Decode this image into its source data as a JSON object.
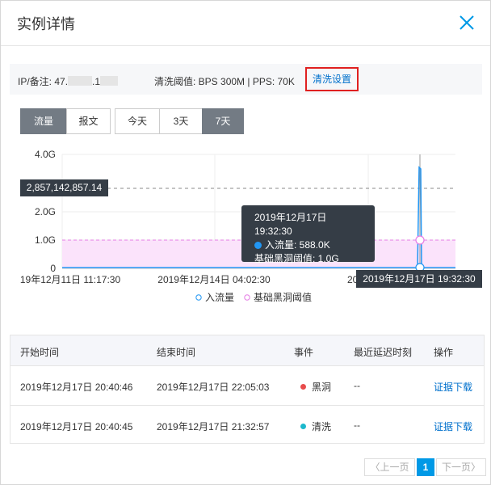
{
  "dialog": {
    "title": "实例详情",
    "close_icon": "close-icon"
  },
  "info": {
    "ip_label": "IP/备注: 47.",
    "ip_mid": ".1",
    "threshold": "清洗阈值: BPS 300M | PPS: 70K",
    "cleaning_link": "清洗设置"
  },
  "tabs": {
    "type": [
      "流量",
      "报文"
    ],
    "range": [
      "今天",
      "3天",
      "7天"
    ],
    "active_type": "流量",
    "active_range": "7天"
  },
  "chart_data": {
    "type": "line",
    "y_ticks": [
      "4.0G",
      "2.0G",
      "1.0G",
      "0"
    ],
    "x_ticks": [
      "19年12月11日 11:17:30",
      "2019年12月14日 04:02:30",
      "2019年12"
    ],
    "crosshair_y_label": "2,857,142,857.14",
    "crosshair_x_label": "2019年12月17日 19:32:30",
    "series": [
      {
        "name": "入流量",
        "color": "#2196f3",
        "values": [
          0,
          0,
          0,
          0,
          0,
          0,
          3600000000,
          588000
        ]
      },
      {
        "name": "基础黑洞阈值",
        "color": "#e57ce5",
        "values": [
          1000000000,
          1000000000,
          1000000000,
          1000000000,
          1000000000,
          1000000000,
          1000000000,
          1000000000
        ]
      }
    ],
    "ylim": [
      0,
      4000000000
    ],
    "legend": "bottom",
    "tooltip": {
      "time": "2019年12月17日 19:32:30",
      "inflow": "入流量: 588.0K",
      "threshold": "基础黑洞阈值: 1.0G"
    }
  },
  "table": {
    "headers": [
      "开始时间",
      "结束时间",
      "事件",
      "最近延迟时刻",
      "操作"
    ],
    "rows": [
      {
        "start": "2019年12月17日 20:40:46",
        "end": "2019年12月17日 22:05:03",
        "event": "黑洞",
        "event_color": "#e84c4c",
        "delay": "--",
        "action": "证据下载"
      },
      {
        "start": "2019年12月17日 20:40:45",
        "end": "2019年12月17日 21:32:57",
        "event": "清洗",
        "event_color": "#1cb8cc",
        "delay": "--",
        "action": "证据下载"
      }
    ]
  },
  "pager": {
    "prev": "上一页",
    "current": "1",
    "next": "下一页"
  }
}
